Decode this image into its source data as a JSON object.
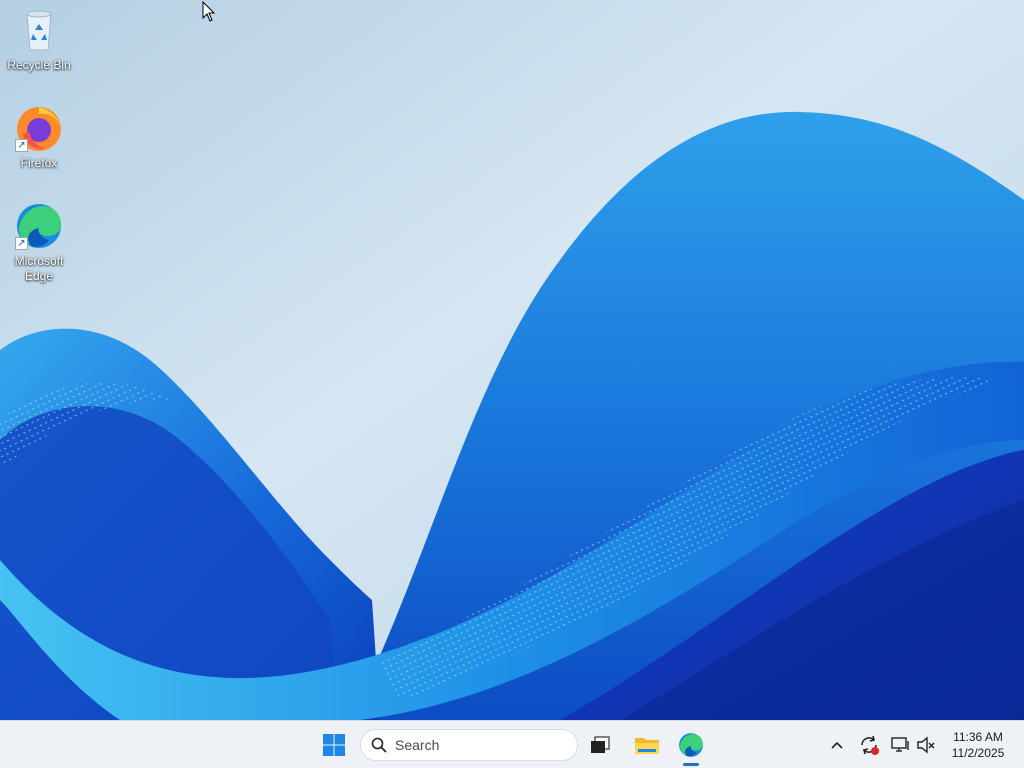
{
  "desktop": {
    "icons": [
      {
        "label": "Recycle Bin"
      },
      {
        "label": "Firefox"
      },
      {
        "label": "Microsoft Edge"
      }
    ]
  },
  "taskbar": {
    "search_placeholder": "Search",
    "pinned": [
      {
        "icon": "windows-logo-icon",
        "name": "Start"
      },
      {
        "icon": "task-view-icon",
        "name": "Task View"
      },
      {
        "icon": "folder-icon",
        "name": "File Explorer"
      },
      {
        "icon": "edge-icon",
        "name": "Microsoft Edge",
        "active": true
      }
    ],
    "tray": [
      {
        "icon": "chevron-up-icon"
      },
      {
        "icon": "sync-icon"
      },
      {
        "icon": "network-icon"
      },
      {
        "icon": "volume-muted-icon"
      }
    ],
    "clock": {
      "time": "11:36 AM",
      "date": "11/2/2025"
    }
  },
  "colors": {
    "accent": "#1e6fd0",
    "taskbar_bg": "#eef1f5",
    "wallpaper_blue": "#1f6fe0"
  }
}
